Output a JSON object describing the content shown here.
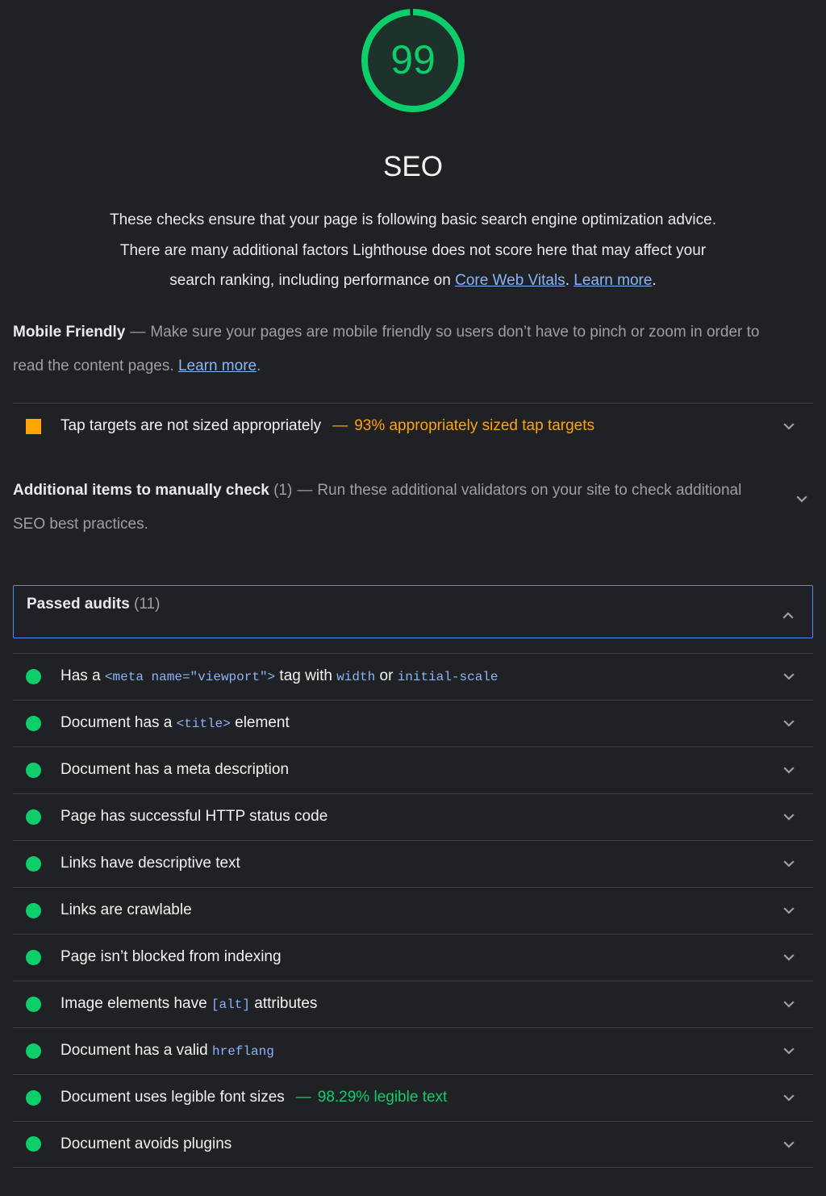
{
  "gauge": {
    "score": "99",
    "score_percent": 99,
    "title": "SEO",
    "color_pass": "#0CCE6B"
  },
  "description": {
    "part1": "These checks ensure that your page is following basic search engine optimization advice. There are many additional factors Lighthouse does not score here that may affect your search ranking, including performance on ",
    "link1": "Core Web Vitals",
    "mid": ". ",
    "link2": "Learn more",
    "end": "."
  },
  "groups": [
    {
      "title": "Mobile Friendly",
      "dash": "—",
      "description_a": "Make sure your pages are mobile friendly so users don’t have to pinch or zoom in order to read the content pages. ",
      "link": "Learn more",
      "description_b": ".",
      "audits": [
        {
          "icon": "square-warning-icon",
          "status": "average",
          "title": "Tap targets are not sized appropriately",
          "value_dash": "—",
          "value": "93% appropriately sized tap targets",
          "chevron": "chevron-down-icon"
        }
      ]
    }
  ],
  "manual_group": {
    "title": "Additional items to manually check",
    "count": "(1)",
    "dash": "—",
    "description": "Run these additional validators on your site to check additional SEO best practices.",
    "chevron": "chevron-down-icon"
  },
  "passed": {
    "label": "Passed audits",
    "count": "(11)",
    "chevron": "chevron-up-icon",
    "expanded": true,
    "audits": [
      {
        "status": "pass",
        "parts": [
          {
            "type": "text",
            "text": "Has a "
          },
          {
            "type": "code",
            "text": "<meta name=\"viewport\">"
          },
          {
            "type": "text",
            "text": " tag with "
          },
          {
            "type": "code",
            "text": "width"
          },
          {
            "type": "text",
            "text": " or "
          },
          {
            "type": "code",
            "text": "initial-scale"
          }
        ],
        "value_dash": "",
        "value": "",
        "chevron": "chevron-down-icon"
      },
      {
        "status": "pass",
        "parts": [
          {
            "type": "text",
            "text": "Document has a "
          },
          {
            "type": "code",
            "text": "<title>"
          },
          {
            "type": "text",
            "text": " element"
          }
        ],
        "value_dash": "",
        "value": "",
        "chevron": "chevron-down-icon"
      },
      {
        "status": "pass",
        "parts": [
          {
            "type": "text",
            "text": "Document has a meta description"
          }
        ],
        "value_dash": "",
        "value": "",
        "chevron": "chevron-down-icon"
      },
      {
        "status": "pass",
        "parts": [
          {
            "type": "text",
            "text": "Page has successful HTTP status code"
          }
        ],
        "value_dash": "",
        "value": "",
        "chevron": "chevron-down-icon"
      },
      {
        "status": "pass",
        "parts": [
          {
            "type": "text",
            "text": "Links have descriptive text"
          }
        ],
        "value_dash": "",
        "value": "",
        "chevron": "chevron-down-icon"
      },
      {
        "status": "pass",
        "parts": [
          {
            "type": "text",
            "text": "Links are crawlable"
          }
        ],
        "value_dash": "",
        "value": "",
        "chevron": "chevron-down-icon"
      },
      {
        "status": "pass",
        "parts": [
          {
            "type": "text",
            "text": "Page isn’t blocked from indexing"
          }
        ],
        "value_dash": "",
        "value": "",
        "chevron": "chevron-down-icon"
      },
      {
        "status": "pass",
        "parts": [
          {
            "type": "text",
            "text": "Image elements have "
          },
          {
            "type": "code",
            "text": "[alt]"
          },
          {
            "type": "text",
            "text": " attributes"
          }
        ],
        "value_dash": "",
        "value": "",
        "chevron": "chevron-down-icon"
      },
      {
        "status": "pass",
        "parts": [
          {
            "type": "text",
            "text": "Document has a valid "
          },
          {
            "type": "code",
            "text": "hreflang"
          }
        ],
        "value_dash": "",
        "value": "",
        "chevron": "chevron-down-icon"
      },
      {
        "status": "pass",
        "parts": [
          {
            "type": "text",
            "text": "Document uses legible font sizes"
          }
        ],
        "value_dash": "—",
        "value": "98.29% legible text",
        "chevron": "chevron-down-icon"
      },
      {
        "status": "pass",
        "parts": [
          {
            "type": "text",
            "text": "Document avoids plugins"
          }
        ],
        "value_dash": "",
        "value": "",
        "chevron": "chevron-down-icon"
      }
    ]
  }
}
